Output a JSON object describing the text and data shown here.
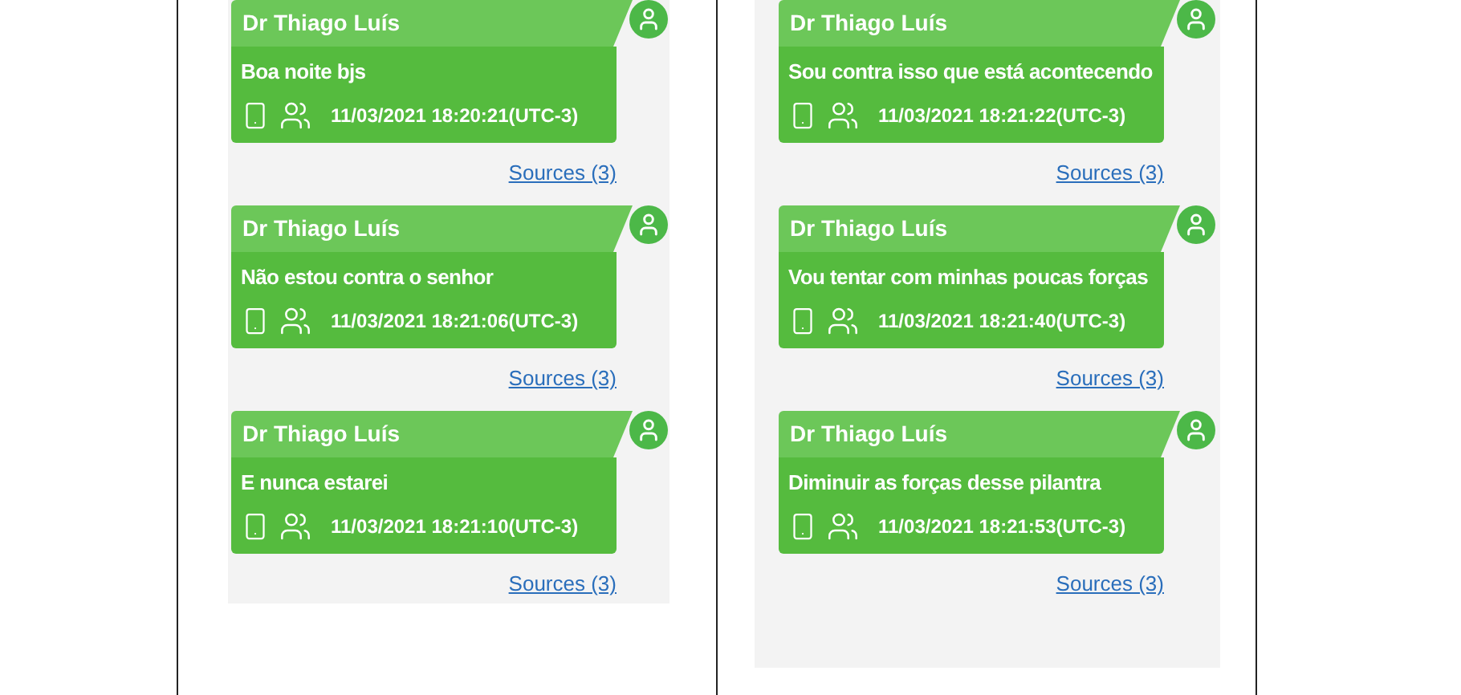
{
  "panels": [
    {
      "messages": [
        {
          "sender": "Dr Thiago Luís",
          "text": "Boa noite bjs",
          "timestamp": "11/03/2021 18:20:21(UTC-3)",
          "sources": "Sources (3)"
        },
        {
          "sender": "Dr Thiago Luís",
          "text": "Não estou contra o senhor",
          "timestamp": "11/03/2021 18:21:06(UTC-3)",
          "sources": "Sources (3)"
        },
        {
          "sender": "Dr Thiago Luís",
          "text": "E nunca estarei",
          "timestamp": "11/03/2021 18:21:10(UTC-3)",
          "sources": "Sources (3)"
        }
      ]
    },
    {
      "messages": [
        {
          "sender": "Dr Thiago Luís",
          "text": "Sou contra isso que está acontecendo",
          "timestamp": "11/03/2021 18:21:22(UTC-3)",
          "sources": "Sources (3)"
        },
        {
          "sender": "Dr Thiago Luís",
          "text": "Vou tentar com minhas poucas forças",
          "timestamp": "11/03/2021 18:21:40(UTC-3)",
          "sources": "Sources (3)"
        },
        {
          "sender": "Dr Thiago Luís",
          "text": "Diminuir as forças desse pilantra",
          "timestamp": "11/03/2021 18:21:53(UTC-3)",
          "sources": "Sources (3)"
        }
      ]
    }
  ]
}
